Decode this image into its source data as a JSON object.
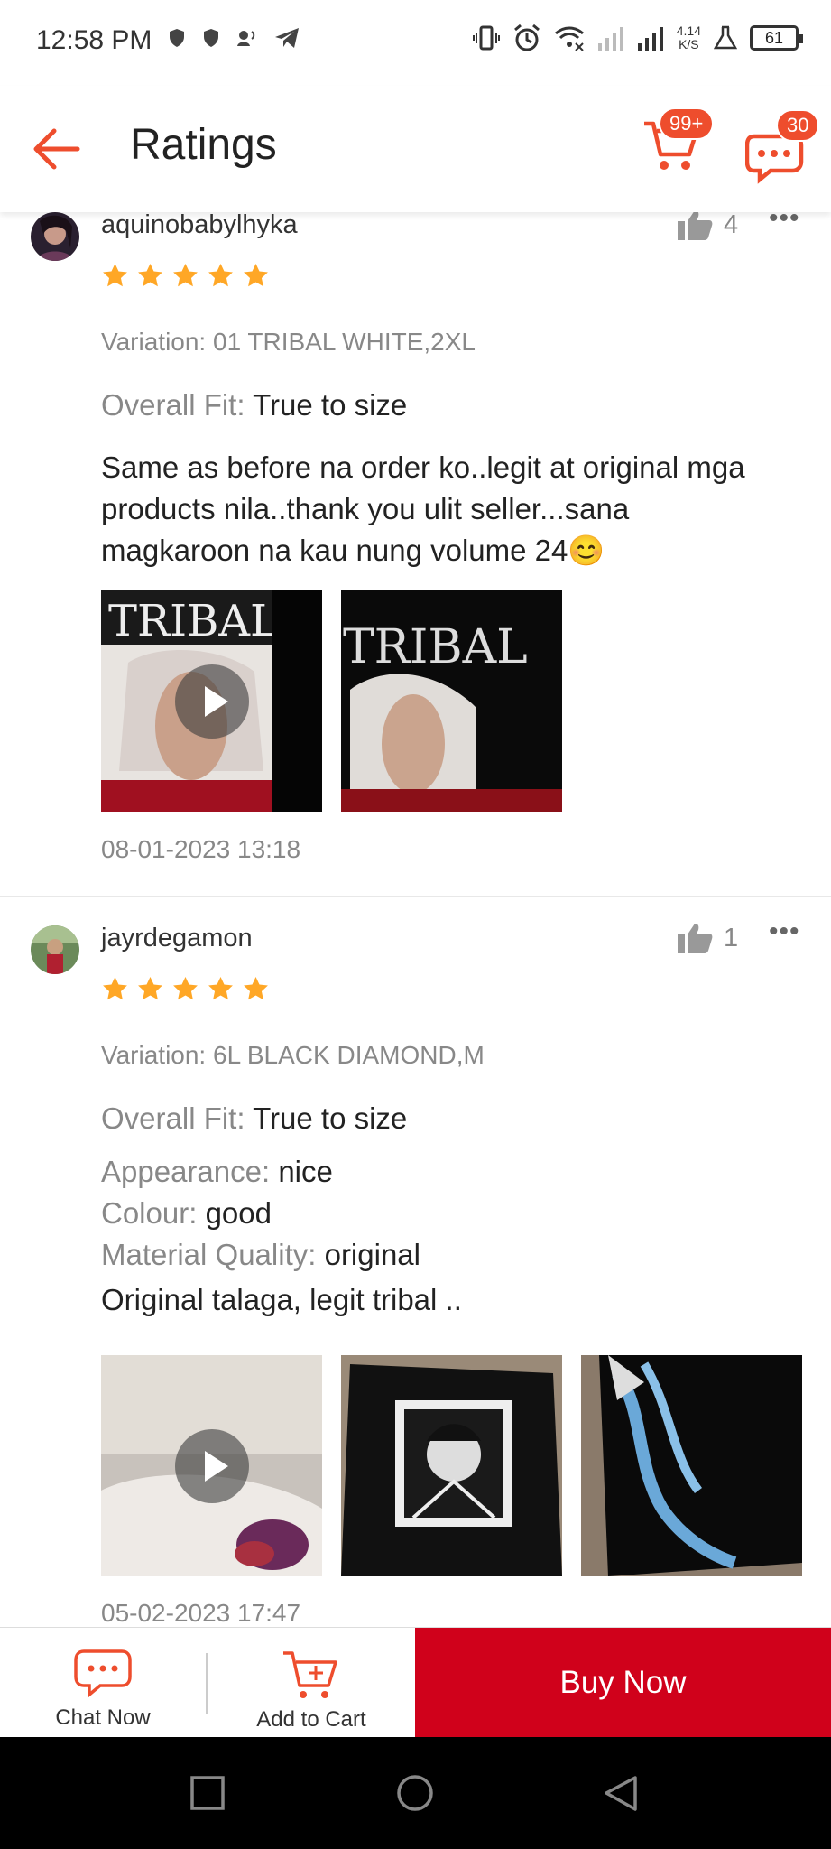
{
  "status": {
    "time": "12:58 PM",
    "speed_top": "4.14",
    "speed_bottom": "K/S",
    "battery": "61"
  },
  "header": {
    "title": "Ratings",
    "cart_badge": "99+",
    "chat_badge": "30"
  },
  "reviews": [
    {
      "username": "aquinobabylhyka",
      "likes": "4",
      "rating": 5,
      "variation": "Variation: 01  TRIBAL WHITE,2XL",
      "fit_label": "Overall Fit:",
      "fit_value": "True to size",
      "comment": "Same as before na order ko..legit at original mga products nila..thank you ulit seller...sana magkaroon na kau nung volume 24😊",
      "date": "08-01-2023 13:18"
    },
    {
      "username": "jayrdegamon",
      "likes": "1",
      "rating": 5,
      "variation": "Variation: 6L  BLACK DIAMOND,M",
      "fit_label": "Overall Fit:",
      "fit_value": "True to size",
      "appearance_label": "Appearance:",
      "appearance_value": "nice",
      "colour_label": "Colour:",
      "colour_value": "good",
      "material_label": "Material Quality:",
      "material_value": "original",
      "comment": "Original talaga, legit tribal ..",
      "date": "05-02-2023 17:47"
    }
  ],
  "bottom_bar": {
    "chat_label": "Chat Now",
    "cart_label": "Add to Cart",
    "buy_label": "Buy Now"
  },
  "colors": {
    "accent": "#ee4d2d",
    "buy_now": "#d0011b",
    "star": "#ffa726"
  }
}
